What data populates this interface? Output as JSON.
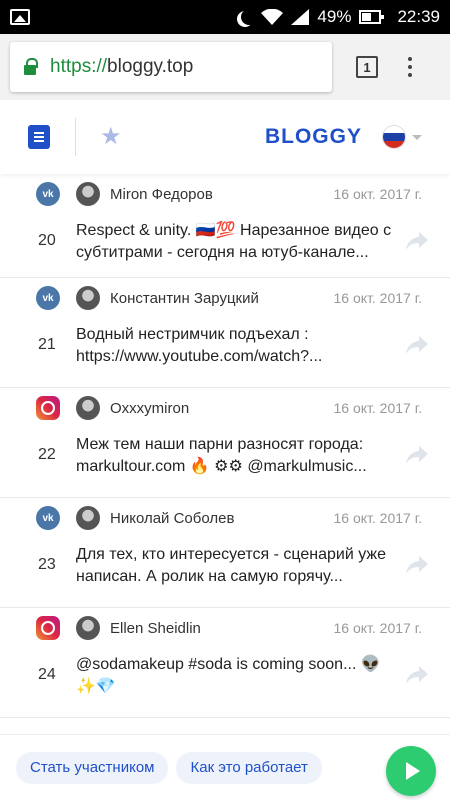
{
  "status_bar": {
    "battery_percent": "49%",
    "time": "22:39"
  },
  "browser": {
    "url_scheme": "https://",
    "url_host": "bloggy.top",
    "tab_count": "1"
  },
  "header": {
    "brand": "BLOGGY"
  },
  "colors": {
    "accent": "#2050c8",
    "vk": "#4a76a8",
    "cta_green": "#2ecc71"
  },
  "posts": [
    {
      "num": "20",
      "source": "vk",
      "author": "Miron Федоров",
      "date": "16 окт. 2017 г.",
      "text": "Respect & unity. 🇷🇺💯 Нарезанное видео с субтитрами - сегодня на ютуб-канале..."
    },
    {
      "num": "21",
      "source": "vk",
      "author": "Константин Заруцкий",
      "date": "16 окт. 2017 г.",
      "text": "Водный нестримчик подъехал : https://www.youtube.com/watch?..."
    },
    {
      "num": "22",
      "source": "instagram",
      "author": "Oxxxymiron",
      "date": "16 окт. 2017 г.",
      "text": "Меж тем наши парни разносят города: markultour.com 🔥 ⚙⚙ @markulmusic..."
    },
    {
      "num": "23",
      "source": "vk",
      "author": "Николай Соболев",
      "date": "16 окт. 2017 г.",
      "text": "Для тех, кто интересуется - сценарий уже написан. А ролик на самую горячу..."
    },
    {
      "num": "24",
      "source": "instagram",
      "author": "Ellen Sheidlin",
      "date": "16 окт. 2017 г.",
      "text": "@sodamakeup #soda is coming soon... 👽✨💎"
    }
  ],
  "bottom": {
    "join_label": "Стать участником",
    "how_label": "Как это работает"
  }
}
